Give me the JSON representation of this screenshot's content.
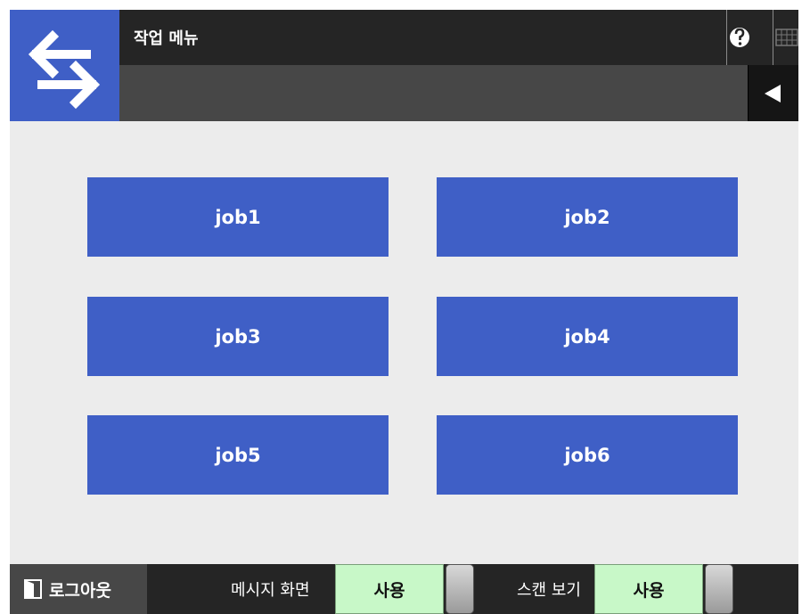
{
  "header": {
    "title": "작업 메뉴",
    "icons": {
      "logo": "swap-arrows-icon",
      "help": "question-circle-icon",
      "keyboard": "keyboard-icon",
      "back": "back-triangle-icon"
    }
  },
  "jobs": [
    {
      "label": "job1"
    },
    {
      "label": "job2"
    },
    {
      "label": "job3"
    },
    {
      "label": "job4"
    },
    {
      "label": "job5"
    },
    {
      "label": "job6"
    }
  ],
  "footer": {
    "logout_label": "로그아웃",
    "message_screen_label": "메시지 화면",
    "message_screen_value": "사용",
    "scan_view_label": "스캔 보기",
    "scan_view_value": "사용"
  },
  "colors": {
    "accent_blue": "#3f5fc6",
    "header_dark": "#252525",
    "subbar": "#474747",
    "toggle_green": "#c8f8c8",
    "background": "#ececec"
  }
}
